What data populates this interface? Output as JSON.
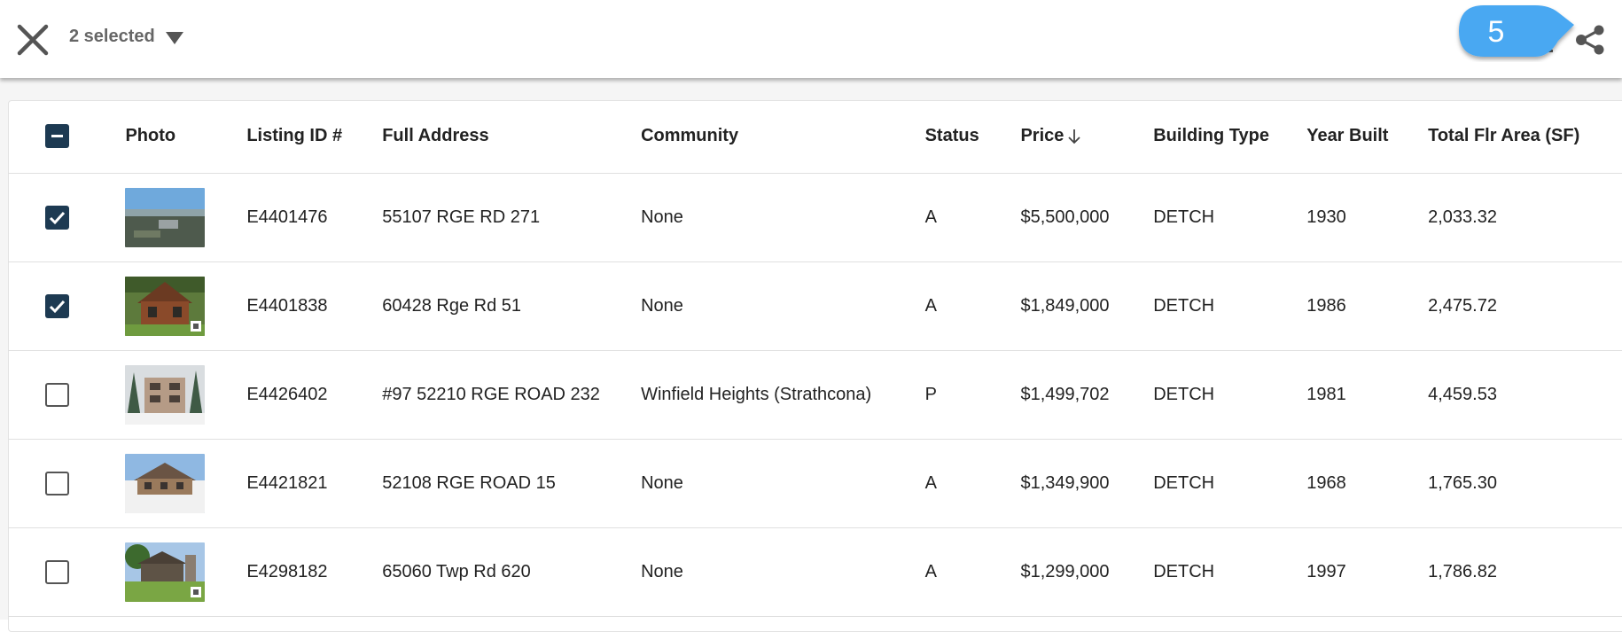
{
  "toolbar": {
    "selected_label": "2 selected",
    "callout_number": "5"
  },
  "colors": {
    "checkbox_checked": "#1d3a52",
    "callout_blue": "#4aa8f2"
  },
  "table": {
    "headers": {
      "photo": "Photo",
      "listing_id": "Listing ID #",
      "address": "Full Address",
      "community": "Community",
      "status": "Status",
      "price": "Price",
      "building_type": "Building Type",
      "year_built": "Year Built",
      "area": "Total Flr Area (SF)"
    },
    "select_all_state": "indeterminate",
    "price_sort": "descending",
    "rows": [
      {
        "checked": true,
        "photo": "aerial-acreage-photo",
        "listing_id": "E4401476",
        "address": "55107 RGE RD 271",
        "community": "None",
        "status": "A",
        "price": "$5,500,000",
        "building_type": "DETCH",
        "year_built": "1930",
        "area": "2,033.32"
      },
      {
        "checked": true,
        "photo": "log-home-photo",
        "listing_id": "E4401838",
        "address": "60428 Rge Rd 51",
        "community": "None",
        "status": "A",
        "price": "$1,849,000",
        "building_type": "DETCH",
        "year_built": "1986",
        "area": "2,475.72"
      },
      {
        "checked": false,
        "photo": "winter-house-photo",
        "listing_id": "E4426402",
        "address": "#97 52210 RGE ROAD 232",
        "community": "Winfield Heights (Strathcona)",
        "status": "P",
        "price": "$1,499,702",
        "building_type": "DETCH",
        "year_built": "1981",
        "area": "4,459.53"
      },
      {
        "checked": false,
        "photo": "snowy-lodge-photo",
        "listing_id": "E4421821",
        "address": "52108 RGE ROAD 15",
        "community": "None",
        "status": "A",
        "price": "$1,349,900",
        "building_type": "DETCH",
        "year_built": "1968",
        "area": "1,765.30"
      },
      {
        "checked": false,
        "photo": "bungalow-yard-photo",
        "listing_id": "E4298182",
        "address": "65060 Twp Rd 620",
        "community": "None",
        "status": "A",
        "price": "$1,299,000",
        "building_type": "DETCH",
        "year_built": "1997",
        "area": "1,786.82"
      }
    ]
  }
}
